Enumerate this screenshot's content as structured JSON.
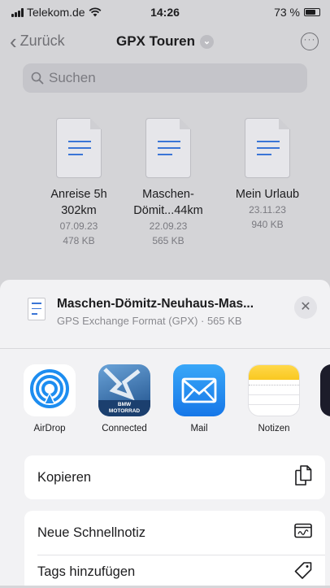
{
  "status": {
    "carrier": "Telekom.de",
    "time": "14:26",
    "battery": "73 %"
  },
  "nav": {
    "back_label": "Zurück",
    "title": "GPX Touren"
  },
  "search": {
    "placeholder": "Suchen"
  },
  "files": [
    {
      "name_line1": "Anreise 5h",
      "name_line2": "302km",
      "date": "07.09.23",
      "size": "478 KB"
    },
    {
      "name_line1": "Maschen-",
      "name_line2": "Dömit...44km",
      "date": "22.09.23",
      "size": "565 KB"
    },
    {
      "name_line1": "Mein Urlaub",
      "name_line2": "",
      "date": "23.11.23",
      "size": "940 KB"
    }
  ],
  "share": {
    "file_title": "Maschen-Dömitz-Neuhaus-Mas...",
    "file_subtitle": "GPS Exchange Format (GPX) · 565 KB",
    "apps": [
      {
        "label": "AirDrop",
        "icon": "airdrop-icon"
      },
      {
        "label": "Connected",
        "icon": "bmw-motorrad-icon",
        "icon_text": [
          "BMW",
          "MOTORRAD"
        ]
      },
      {
        "label": "Mail",
        "icon": "mail-icon"
      },
      {
        "label": "Notizen",
        "icon": "notes-icon"
      }
    ],
    "actions": [
      {
        "label": "Kopieren",
        "icon": "copy-icon"
      },
      {
        "label": "Neue Schnellnotiz",
        "icon": "quick-note-icon"
      },
      {
        "label": "Tags hinzufügen",
        "icon": "tag-icon"
      }
    ]
  },
  "colors": {
    "accent": "#3a75d6",
    "sheet_bg": "#f2f2f4",
    "dimmed_bg": "#d4d4d7"
  }
}
